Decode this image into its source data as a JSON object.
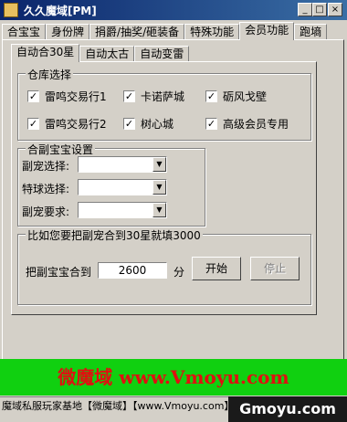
{
  "window": {
    "title": "久久魔域[PM]"
  },
  "tabs": [
    "合宝宝",
    "身份牌",
    "捐爵/抽奖/砸装备",
    "特殊功能",
    "会员功能",
    "跑墒"
  ],
  "subtabs": [
    "自动合30星",
    "自动太古",
    "自动变雷"
  ],
  "warehouse": {
    "legend": "仓库选择",
    "options": [
      {
        "label": "雷鸣交易行1",
        "checked": true
      },
      {
        "label": "卡诺萨城",
        "checked": true
      },
      {
        "label": "砺风戈壁",
        "checked": true
      },
      {
        "label": "雷鸣交易行2",
        "checked": true
      },
      {
        "label": "树心城",
        "checked": true
      },
      {
        "label": "高级会员专用",
        "checked": true
      }
    ]
  },
  "pet_settings": {
    "legend": "合副宝宝设置",
    "fields": [
      {
        "label": "副宠选择:",
        "value": ""
      },
      {
        "label": "特球选择:",
        "value": ""
      },
      {
        "label": "副宠要求:",
        "value": ""
      }
    ]
  },
  "merge": {
    "legend": "比如您要把副宠合到30星就填3000",
    "label": "把副宝宝合到",
    "value": "2600",
    "unit": "分",
    "start": "开始",
    "stop": "停止"
  },
  "banner": "微魔域 www.Vmoyu.com",
  "status": "魔域私服玩家基地【微魔域】【www.Vmoyu.com】",
  "watermark": "Gmoyu.com",
  "colors": {
    "banner_bg": "#10d010",
    "banner_text": "#e01010",
    "titlebar": "#0a246a"
  }
}
